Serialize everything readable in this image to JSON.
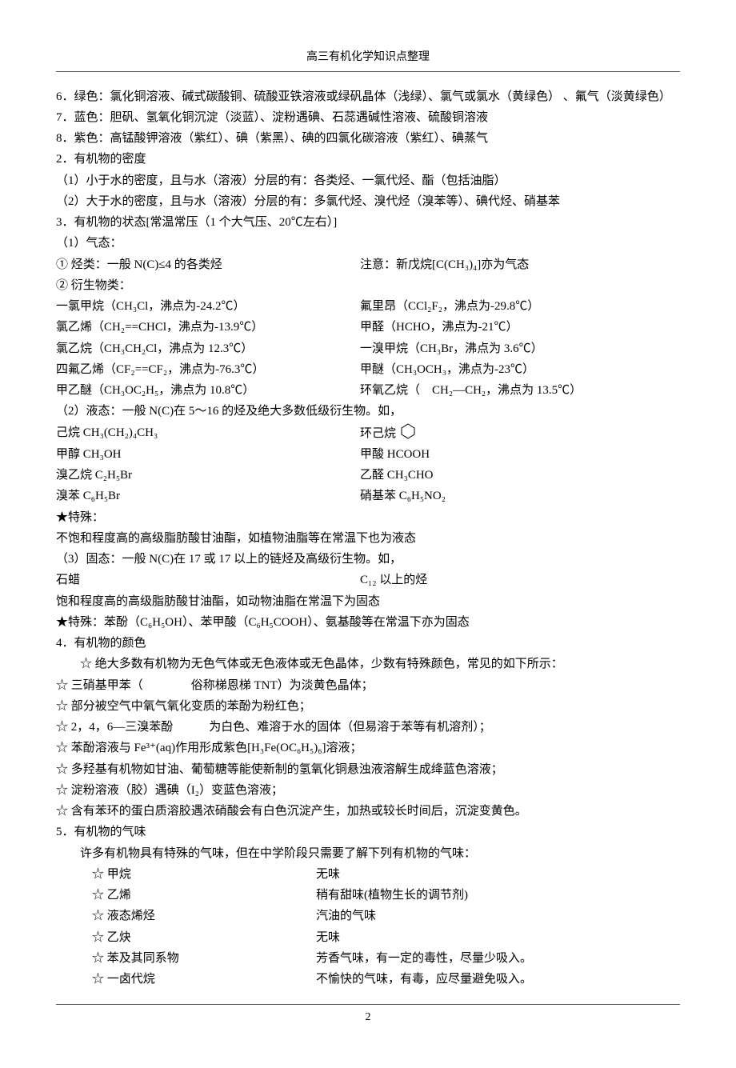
{
  "header": "高三有机化学知识点整理",
  "page_number": "2",
  "lines": {
    "l6": "6．绿色：氯化铜溶液、碱式碳酸铜、硫酸亚铁溶液或绿矾晶体（浅绿）、氯气或氯水（黄绿色） 、氟气（淡黄绿色）",
    "l7": "7．蓝色：胆矾、氢氧化铜沉淀（淡蓝）、淀粉遇碘、石蕊遇碱性溶液、硫酸铜溶液",
    "l8": "8．紫色：高锰酸钾溶液（紫红）、碘（紫黑）、碘的四氯化碳溶液（紫红）、碘蒸气",
    "s2": "2．有机物的密度",
    "s2_1": "（1）小于水的密度，且与水（溶液）分层的有：各类烃、一氯代烃、酯（包括油脂）",
    "s2_2": "（2）大于水的密度，且与水（溶液）分层的有：多氯代烃、溴代烃（溴苯等）、碘代烃、硝基苯",
    "s3": "3．有机物的状态[常温常压（1 个大气压、20℃左右）]",
    "s3_1": "（1）气态：",
    "s3_1a_l": "① 烃类：一般 N(C)≤4 的各类烃",
    "s3_1a_r": "注意：新戊烷[C(CH₃)₄]亦为气态",
    "s3_1b": "② 衍生物类：",
    "d1_l": "一氯甲烷（CH₃Cl，沸点为-24.2℃）",
    "d1_r": "氟里昂（CCl₂F₂，沸点为-29.8℃）",
    "d2_l": "氯乙烯（CH₂==CHCl，沸点为-13.9℃）",
    "d2_r": "甲醛（HCHO，沸点为-21℃）",
    "d3_l": "氯乙烷（CH₃CH₂Cl，沸点为 12.3℃）",
    "d3_r": "一溴甲烷（CH₃Br，沸点为 3.6℃）",
    "d4_l": "四氟乙烯（CF₂==CF₂，沸点为-76.3℃）",
    "d4_r": "甲醚（CH₃OCH₃，沸点为-23℃）",
    "d5_l": "甲乙醚（CH₃OC₂H₅，沸点为 10.8℃）",
    "d5_r": "环氧乙烷（　CH₂—CH₂，沸点为 13.5℃）",
    "s3_2": "（2）液态：一般 N(C)在 5～16 的烃及绝大多数低级衍生物。如，",
    "e1_l": "己烷 CH₃(CH₂)₄CH₃",
    "e1_r": "环己烷",
    "e2_l": "甲醇 CH₃OH",
    "e2_r": "甲酸 HCOOH",
    "e3_l": "溴乙烷 C₂H₅Br",
    "e3_r": "乙醛 CH₃CHO",
    "e4_l": "溴苯 C₆H₅Br",
    "e4_r": "硝基苯 C₆H₅NO₂",
    "star1": "★特殊：",
    "star1_t": "不饱和程度高的高级脂肪酸甘油酯，如植物油脂等在常温下也为液态",
    "s3_3": "（3）固态：一般 N(C)在 17 或 17 以上的链烃及高级衍生物。如，",
    "f1_l": "石蜡",
    "f1_r": "C₁₂ 以上的烃",
    "f2": "饱和程度高的高级脂肪酸甘油酯，如动物油脂在常温下为固态",
    "star2": "★特殊：苯酚（C₆H₅OH）、苯甲酸（C₆H₅COOH）、氨基酸等在常温下亦为固态",
    "s4": "4．有机物的颜色",
    "s4_0": "☆ 绝大多数有机物为无色气体或无色液体或无色晶体，少数有特殊颜色，常见的如下所示：",
    "s4_1": "☆ 三硝基甲苯（　　　　俗称梯恩梯 TNT）为淡黄色晶体；",
    "s4_2": "☆ 部分被空气中氧气氧化变质的苯酚为粉红色；",
    "s4_3": "☆ 2，4，6—三溴苯酚　　　为白色、难溶于水的固体（但易溶于苯等有机溶剂）；",
    "s4_4": "☆ 苯酚溶液与 Fe³⁺(aq)作用形成紫色[H₃Fe(OC₆H₅)₆]溶液；",
    "s4_5": "☆ 多羟基有机物如甘油、葡萄糖等能使新制的氢氧化铜悬浊液溶解生成绛蓝色溶液；",
    "s4_6": "☆ 淀粉溶液（胶）遇碘（I₂）变蓝色溶液；",
    "s4_7": "☆ 含有苯环的蛋白质溶胶遇浓硝酸会有白色沉淀产生，加热或较长时间后，沉淀变黄色。",
    "s5": "5．有机物的气味",
    "s5_0": "许多有机物具有特殊的气味，但在中学阶段只需要了解下列有机物的气味：",
    "g1_l": "☆ 甲烷",
    "g1_r": "无味",
    "g2_l": "☆ 乙烯",
    "g2_r": "稍有甜味(植物生长的调节剂)",
    "g3_l": "☆ 液态烯烃",
    "g3_r": "汽油的气味",
    "g4_l": "☆ 乙炔",
    "g4_r": "无味",
    "g5_l": "☆ 苯及其同系物",
    "g5_r": "芳香气味，有一定的毒性，尽量少吸入。",
    "g6_l": "☆ 一卤代烷",
    "g6_r": "不愉快的气味，有毒，应尽量避免吸入。"
  }
}
